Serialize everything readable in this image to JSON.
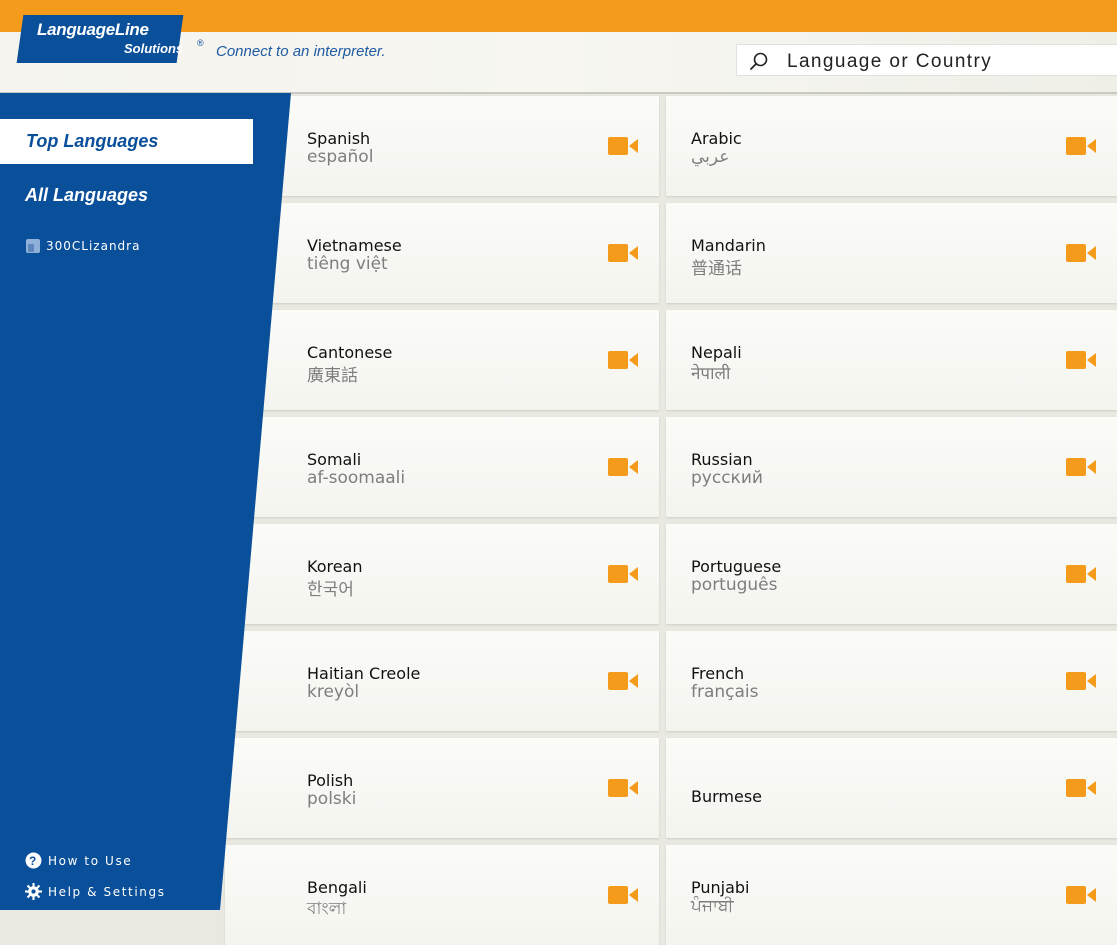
{
  "header": {
    "logo_line1": "LanguageLine",
    "logo_line2": "Solutions",
    "logo_reg": "®",
    "tagline": "Connect to an interpreter.",
    "search_placeholder": "Language or Country"
  },
  "sidebar": {
    "top_languages": "Top Languages",
    "all_languages": "All Languages",
    "user": "300CLizandra",
    "how_to_use": "How to Use",
    "help_settings": "Help & Settings"
  },
  "colors": {
    "brand_blue": "#0a4f9a",
    "accent_orange": "#f59b1c"
  },
  "languages": [
    {
      "name": "Spanish",
      "native": "español"
    },
    {
      "name": "Arabic",
      "native": "عربي"
    },
    {
      "name": "Vietnamese",
      "native": "tiêng việt"
    },
    {
      "name": "Mandarin",
      "native": "普通话"
    },
    {
      "name": "Cantonese",
      "native": "廣東話"
    },
    {
      "name": "Nepali",
      "native": "नेपाली"
    },
    {
      "name": "Somali",
      "native": "af-soomaali"
    },
    {
      "name": "Russian",
      "native": "русский"
    },
    {
      "name": "Korean",
      "native": "한국어"
    },
    {
      "name": "Portuguese",
      "native": "português"
    },
    {
      "name": "Haitian Creole",
      "native": "kreyòl"
    },
    {
      "name": "French",
      "native": "français"
    },
    {
      "name": "Polish",
      "native": "polski"
    },
    {
      "name": "Burmese",
      "native": ""
    },
    {
      "name": "Bengali",
      "native": "বাংলা"
    },
    {
      "name": "Punjabi",
      "native": "ਪੰਜਾਬੀ"
    }
  ]
}
